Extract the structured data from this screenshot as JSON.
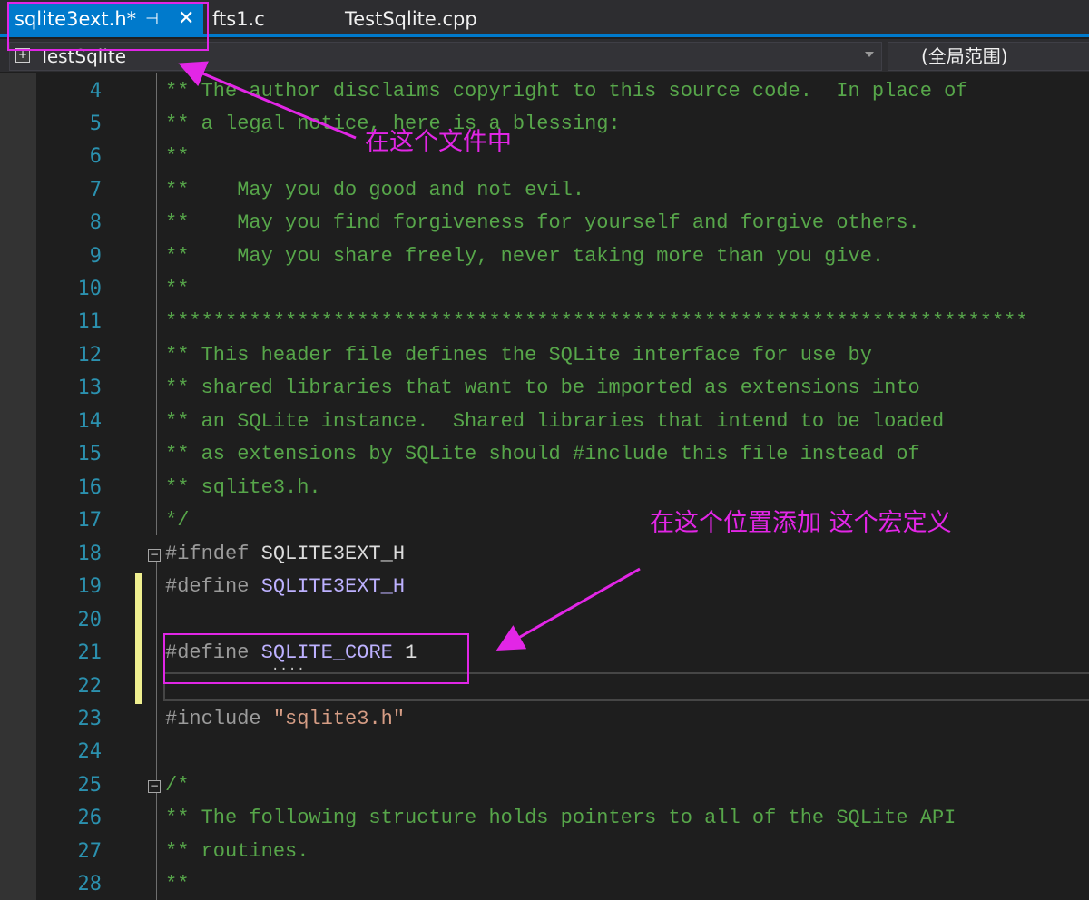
{
  "tabs": [
    {
      "label": "sqlite3ext.h*",
      "pin_icon": "⊣",
      "close_icon": "✕",
      "active": true
    },
    {
      "label": "fts1.c",
      "active": false
    },
    {
      "label": "TestSqlite.cpp",
      "active": false
    }
  ],
  "navbar": {
    "project": "TestSqlite",
    "scope": "(全局范围)"
  },
  "editor": {
    "line_numbers": [
      "4",
      "5",
      "6",
      "7",
      "8",
      "9",
      "10",
      "11",
      "12",
      "13",
      "14",
      "15",
      "16",
      "17",
      "18",
      "19",
      "20",
      "21",
      "22",
      "23",
      "24",
      "25",
      "26",
      "27",
      "28"
    ],
    "lines": {
      "l4": "** The author disclaims copyright to this source code.  In place of",
      "l5": "** a legal notice, here is a blessing:",
      "l6": "**",
      "l7": "**    May you do good and not evil.",
      "l8": "**    May you find forgiveness for yourself and forgive others.",
      "l9": "**    May you share freely, never taking more than you give.",
      "l10": "**",
      "l11": "************************************************************************",
      "l12": "** This header file defines the SQLite interface for use by",
      "l13": "** shared libraries that want to be imported as extensions into",
      "l14": "** an SQLite instance.  Shared libraries that intend to be loaded",
      "l15": "** as extensions by SQLite should #include this file instead of",
      "l16": "** sqlite3.h.",
      "l17": "*/",
      "l18_kw": "#ifndef",
      "l18_macro": "SQLITE3EXT_H",
      "l19_kw": "#define",
      "l19_macro": "SQLITE3EXT_H",
      "l21_kw": "#define",
      "l21_macro": "SQLITE_CORE",
      "l21_val": "1",
      "l23_kw": "#include",
      "l23_str": "\"sqlite3.h\"",
      "l25": "/*",
      "l26": "** The following structure holds pointers to all of the SQLite API",
      "l27": "** routines.",
      "l28": "**"
    },
    "ellipsis": "····"
  },
  "annotations": {
    "note1": "在这个文件中",
    "note2": "在这个位置添加 这个宏定义",
    "color": "#e226e6"
  }
}
